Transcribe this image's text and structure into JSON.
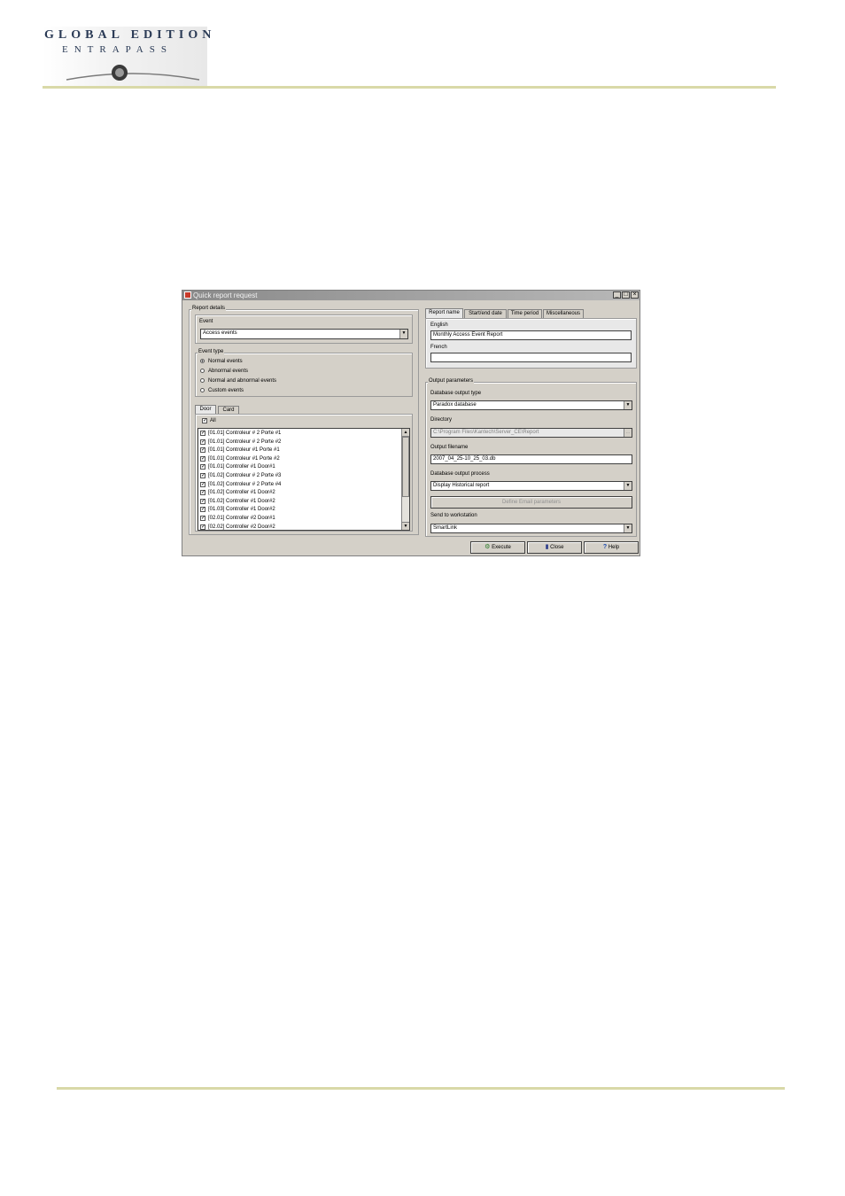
{
  "header": {
    "logo_line1": "GLOBAL EDITION",
    "logo_line2": "ENTRAPASS"
  },
  "window": {
    "title": "Quick report request"
  },
  "left": {
    "report_details_label": "Report details",
    "event_label": "Event",
    "event_value": "Access events",
    "event_type_label": "Event type",
    "event_types": [
      {
        "label": "Normal events",
        "selected": true
      },
      {
        "label": "Abnormal events",
        "selected": false
      },
      {
        "label": "Normal and abnormal events",
        "selected": false
      },
      {
        "label": "Custom events",
        "selected": false
      }
    ],
    "tabs": [
      "Door",
      "Card"
    ],
    "all_label": "All",
    "doors": [
      "[01.01] Controleur # 2 Porte #1",
      "[01.01] Controleur # 2 Porte #2",
      "[01.01] Controleur #1 Porte #1",
      "[01.01] Controleur #1 Porte #2",
      "[01.01] Controller #1 Door#1",
      "[01.02] Controleur # 2 Porte #3",
      "[01.02] Controleur # 2 Porte #4",
      "[01.02] Controller #1 Door#2",
      "[01.02] Controller #1 Door#2",
      "[01.03] Controller #1 Door#2",
      "[02.01] Controller #2 Door#1",
      "[02.02] Controller #2 Door#2"
    ]
  },
  "right": {
    "tabs": [
      "Report name",
      "Start/end date",
      "Time period",
      "Miscellaneous"
    ],
    "english_label": "English",
    "english_value": "Monthly Access Event Report",
    "french_label": "French",
    "french_value": "",
    "output_params_label": "Output parameters",
    "db_type_label": "Database output type",
    "db_type_value": "Paradox database",
    "directory_label": "Directory",
    "directory_value": "C:\\Program Files\\Kantech\\Server_CE\\Report",
    "filename_label": "Output filename",
    "filename_value": "2007_04_25-10_25_03.db",
    "process_label": "Database output process",
    "process_value": "Display Historical report",
    "email_button": "Define Email parameters",
    "workstation_label": "Send to workstation",
    "workstation_value": "SmartLink"
  },
  "buttons": {
    "execute": "Execute",
    "close": "Close",
    "help": "Help"
  }
}
